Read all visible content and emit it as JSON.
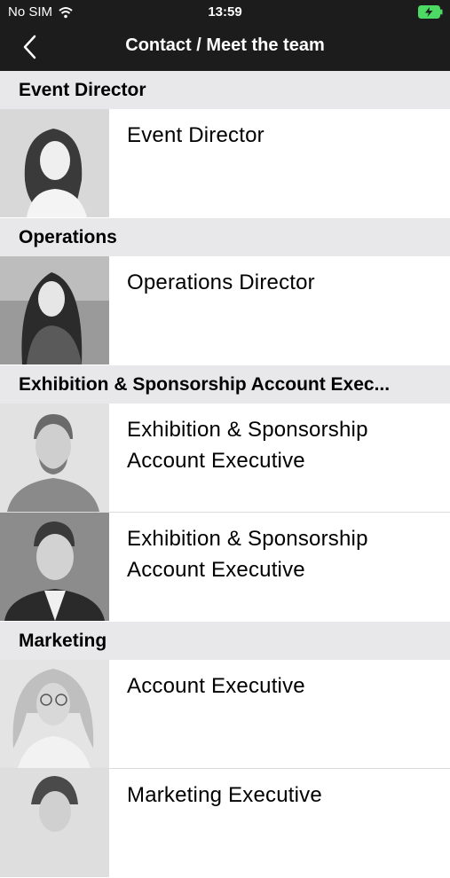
{
  "status_bar": {
    "carrier": "No SIM",
    "time": "13:59"
  },
  "header": {
    "title": "Contact / Meet the team"
  },
  "sections": [
    {
      "title": "Event Director",
      "rows": [
        {
          "role": "Event Director"
        }
      ]
    },
    {
      "title": "Operations",
      "rows": [
        {
          "role": "Operations Director"
        }
      ]
    },
    {
      "title": "Exhibition & Sponsorship Account Exec...",
      "rows": [
        {
          "role": "Exhibition & Sponsorship Account Executive"
        },
        {
          "role": "Exhibition & Sponsorship Account Executive"
        }
      ]
    },
    {
      "title": "Marketing",
      "rows": [
        {
          "role": "Account Executive"
        },
        {
          "role": "Marketing Executive"
        }
      ]
    }
  ],
  "icons": {
    "back": "chevron-left-icon",
    "wifi": "wifi-icon",
    "battery": "battery-charging-icon"
  },
  "colors": {
    "header_bg": "#1c1c1c",
    "section_bg": "#e8e8ea",
    "battery": "#4cd964"
  }
}
